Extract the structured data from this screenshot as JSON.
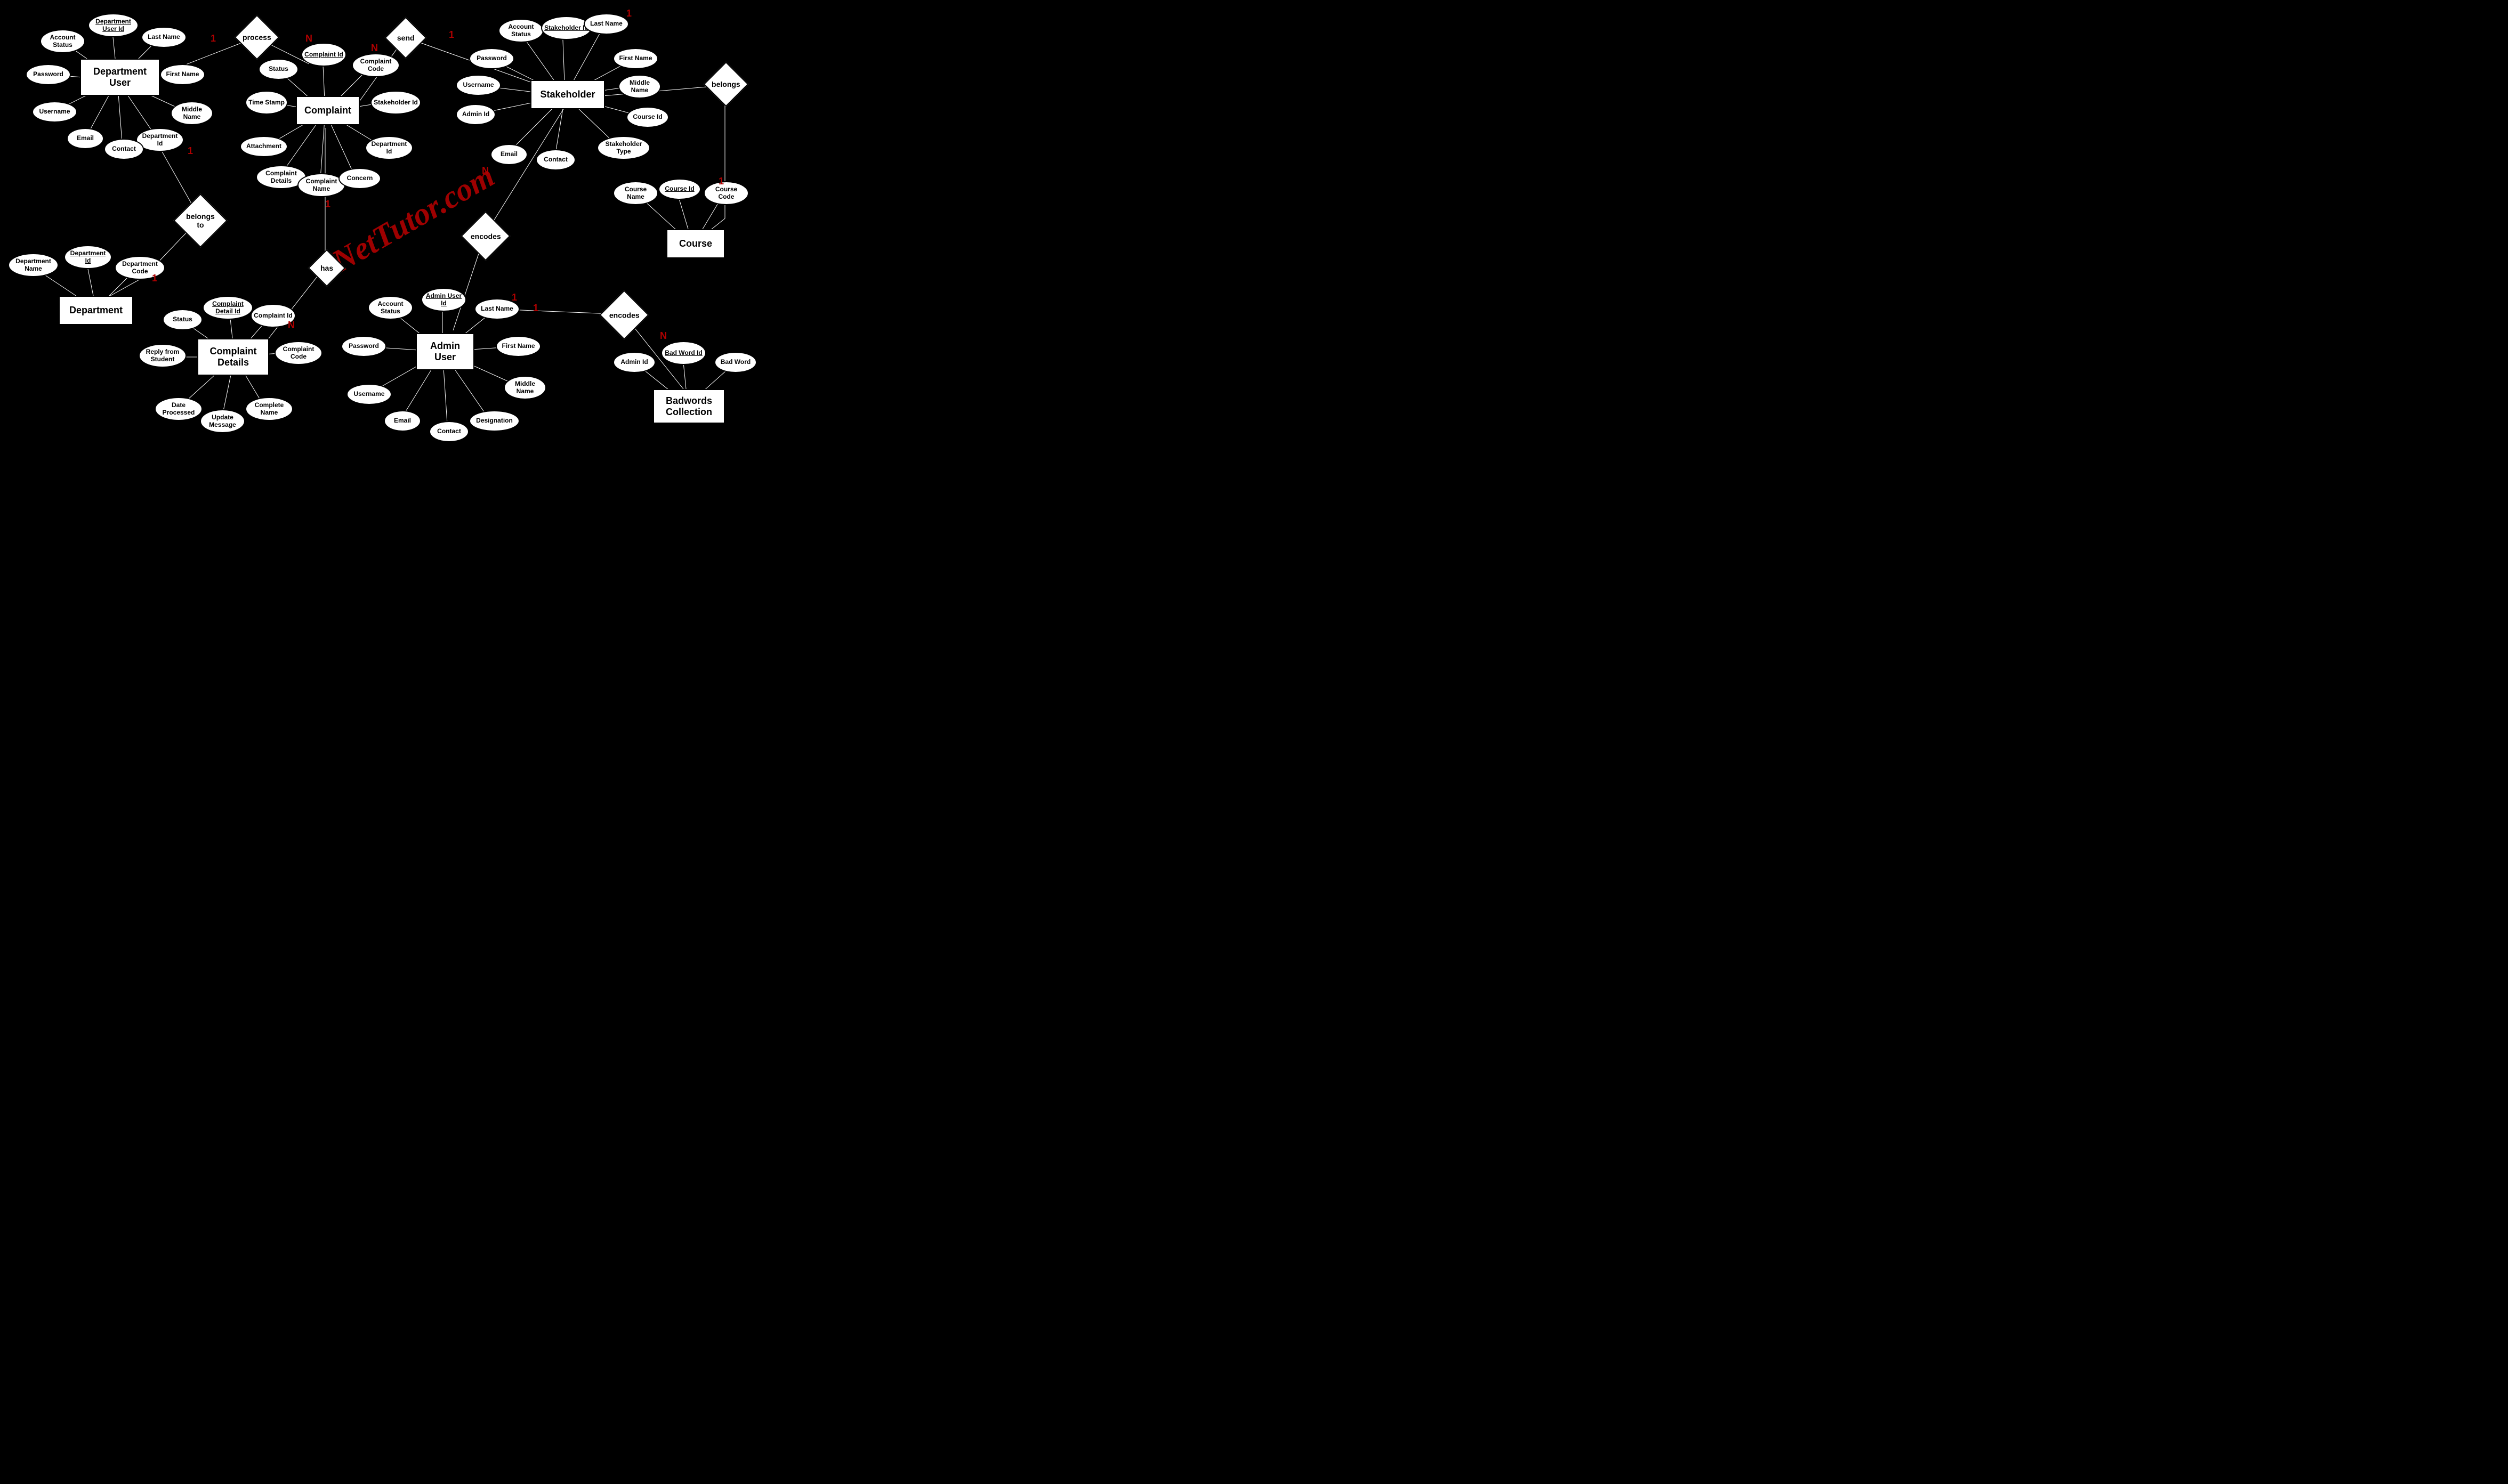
{
  "watermark": "iNetTutor.com",
  "entities": {
    "department_user": "Department User",
    "complaint": "Complaint",
    "stakeholder": "Stakeholder",
    "department": "Department",
    "complaint_details": "Complaint Details",
    "admin_user": "Admin User",
    "course": "Course",
    "badwords": "Badwords Collection"
  },
  "relationships": {
    "process": "process",
    "send": "send",
    "belongs": "belongs",
    "belongs_to": "belongs to",
    "has": "has",
    "encodes1": "encodes",
    "encodes2": "encodes"
  },
  "attributes": {
    "du_account_status": "Account Status",
    "du_department_user_id": "Department User Id",
    "du_last_name": "Last Name",
    "du_first_name": "First Name",
    "du_middle_name": "Middle Name",
    "du_department_id": "Department Id",
    "du_contact": "Contact",
    "du_email": "Email",
    "du_username": "Username",
    "du_password": "Password",
    "c_complaint_id": "Complaint Id",
    "c_status": "Status",
    "c_time_stamp": "Time Stamp",
    "c_attachment": "Attachment",
    "c_complaint_details": "Complaint Details",
    "c_complaint_name": "Complaint Name",
    "c_concern": "Concern",
    "c_department_id": "Department Id",
    "c_stakeholder_id": "Stakeholder Id",
    "c_complaint_code": "Complaint Code",
    "sh_account_status": "Account Status",
    "sh_stakeholder_id": "Stakeholder Id",
    "sh_last_name": "Last Name",
    "sh_first_name": "First Name",
    "sh_middle_name": "Middle Name",
    "sh_course_id": "Course Id",
    "sh_stakeholder_type": "Stakeholder Type",
    "sh_contact": "Contact",
    "sh_email": "Email",
    "sh_admin_id": "Admin Id",
    "sh_username": "Username",
    "sh_password": "Password",
    "d_department_name": "Department Name",
    "d_department_id": "Department Id",
    "d_department_code": "Department Code",
    "cd_complaint_detail_id": "Complaint Detail Id",
    "cd_complaint_id": "Complaint Id",
    "cd_complaint_code": "Complaint Code",
    "cd_status": "Status",
    "cd_reply_from_student": "Reply from Student",
    "cd_date_processed": "Date Processed",
    "cd_update_message": "Update Message",
    "cd_complete_name": "Complete Name",
    "au_account_status": "Account Status",
    "au_admin_user_id": "Admin User Id",
    "au_last_name": "Last Name",
    "au_first_name": "First Name",
    "au_middle_name": "Middle Name",
    "au_designation": "Designation",
    "au_contact": "Contact",
    "au_email": "Email",
    "au_username": "Username",
    "au_password": "Password",
    "co_course_name": "Course Name",
    "co_course_id": "Course Id",
    "co_course_code": "Course Code",
    "bw_admin_id": "Admin Id",
    "bw_bad_word_id": "Bad Word Id",
    "bw_bad_word": "Bad Word"
  },
  "cardinalities": {
    "process_1": "1",
    "process_n": "N",
    "send_1": "1",
    "send_n": "N",
    "sh_lastname_1": "1",
    "belongs_1": "1",
    "belongs_to_1a": "1",
    "belongs_to_1b": "1",
    "has_1": "1",
    "has_n": "N",
    "encodes1_n": "N",
    "au_last_1a": "1",
    "au_last_1b": "1",
    "encodes2_n": "N"
  }
}
